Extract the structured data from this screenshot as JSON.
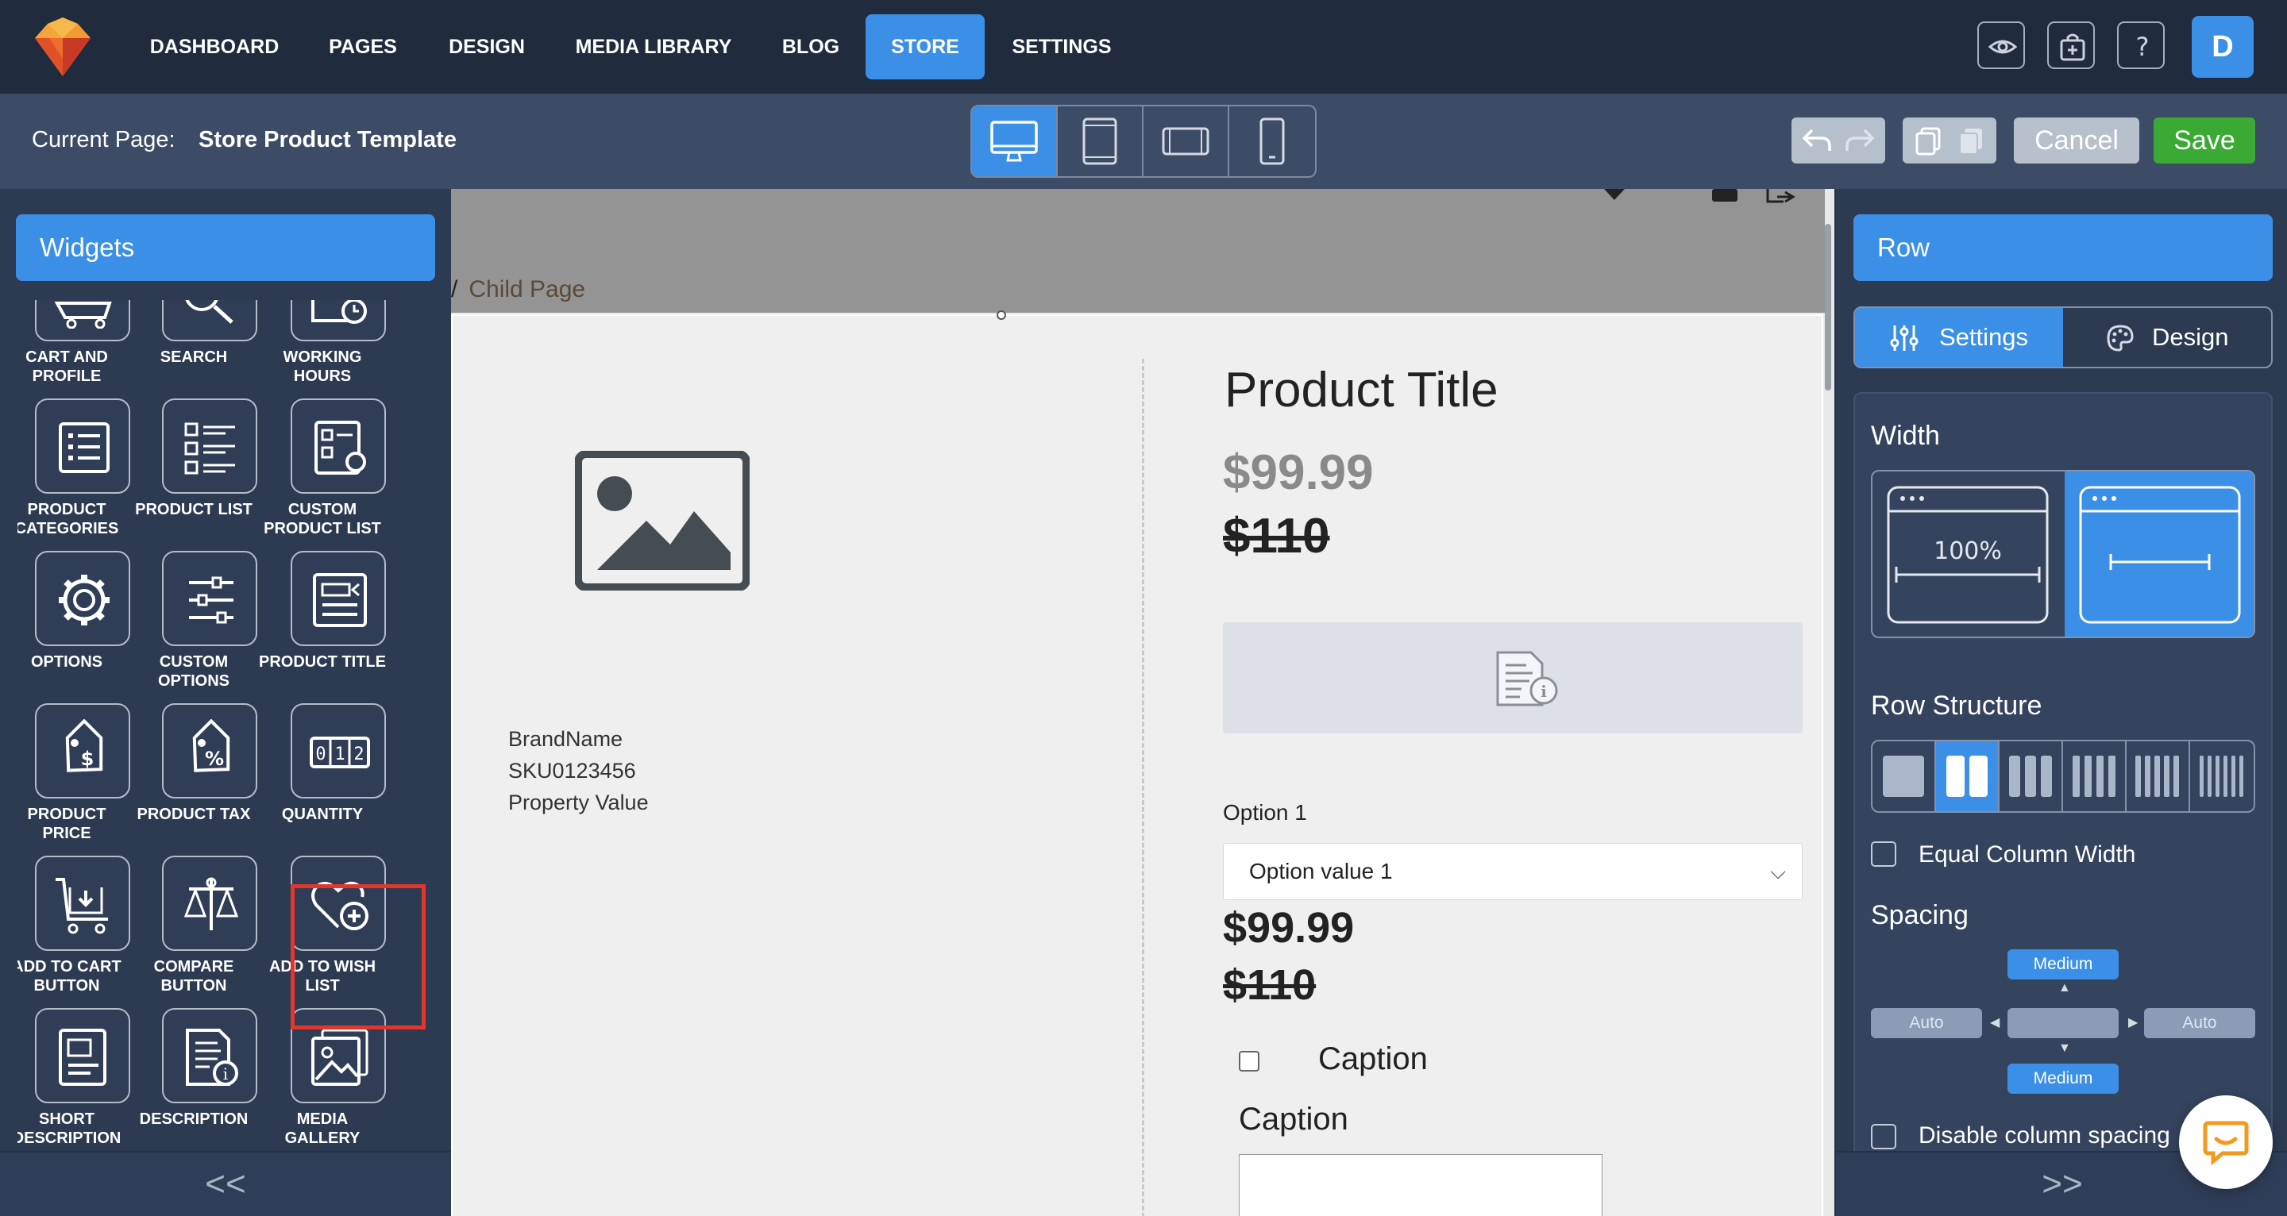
{
  "nav": {
    "items": [
      {
        "label": "DASHBOARD"
      },
      {
        "label": "PAGES"
      },
      {
        "label": "DESIGN"
      },
      {
        "label": "MEDIA LIBRARY"
      },
      {
        "label": "BLOG"
      },
      {
        "label": "STORE"
      },
      {
        "label": "SETTINGS"
      }
    ],
    "active": "STORE",
    "avatar_letter": "D",
    "icons": [
      "eye-icon",
      "store-icon",
      "help-icon"
    ]
  },
  "subbar": {
    "current_page_label": "Current Page:",
    "current_page_value": "Store Product Template",
    "devices": [
      "desktop-icon",
      "tablet-icon",
      "tablet-landscape-icon",
      "mobile-icon"
    ],
    "active_device": "desktop",
    "cancel_label": "Cancel",
    "save_label": "Save"
  },
  "left_panel": {
    "title": "Widgets",
    "widgets": [
      {
        "label": "CART AND PROFILE",
        "icon": "cart-icon"
      },
      {
        "label": "SEARCH",
        "icon": "search-icon"
      },
      {
        "label": "WORKING HOURS",
        "icon": "clock-icon"
      },
      {
        "label": "PRODUCT CATEGORIES",
        "icon": "list-icon"
      },
      {
        "label": "PRODUCT LIST",
        "icon": "product-list-icon"
      },
      {
        "label": "CUSTOM PRODUCT LIST",
        "icon": "custom-list-icon"
      },
      {
        "label": "OPTIONS",
        "icon": "gear-icon"
      },
      {
        "label": "CUSTOM OPTIONS",
        "icon": "sliders-icon"
      },
      {
        "label": "PRODUCT TITLE",
        "icon": "title-icon"
      },
      {
        "label": "PRODUCT PRICE",
        "icon": "price-tag-icon"
      },
      {
        "label": "PRODUCT TAX",
        "icon": "tax-tag-icon"
      },
      {
        "label": "QUANTITY",
        "icon": "quantity-icon"
      },
      {
        "label": "ADD TO CART BUTTON",
        "icon": "add-to-cart-icon"
      },
      {
        "label": "COMPARE BUTTON",
        "icon": "scale-icon"
      },
      {
        "label": "ADD TO WISH LIST",
        "icon": "heart-plus-icon"
      },
      {
        "label": "SHORT DESCRIPTION",
        "icon": "short-description-icon"
      },
      {
        "label": "DESCRIPTION",
        "icon": "description-icon"
      },
      {
        "label": "MEDIA GALLERY",
        "icon": "gallery-icon"
      }
    ],
    "highlighted": "QUANTITY",
    "footer": "<<"
  },
  "canvas": {
    "breadcrumb_sep": "/",
    "breadcrumb": "Child Page",
    "product_title": "Product Title",
    "price": "$99.99",
    "old_price": "$110",
    "brand": "BrandName",
    "sku": "SKU0123456",
    "property": "Property Value",
    "option_label": "Option 1",
    "option_value": "Option value 1",
    "caption_checkbox": "Caption",
    "caption_label": "Caption"
  },
  "right_panel": {
    "title": "Row",
    "tabs": [
      {
        "label": "Settings"
      },
      {
        "label": "Design"
      }
    ],
    "active_tab": "Settings",
    "width_title": "Width",
    "width_full_label": "100%",
    "row_structure_title": "Row Structure",
    "row_structure_active": 2,
    "equal_column_width": "Equal Column Width",
    "spacing_title": "Spacing",
    "spacing_top": "Medium",
    "spacing_bottom": "Medium",
    "spacing_left": "Auto",
    "spacing_right": "Auto",
    "disable_column_spacing": "Disable column spacing",
    "footer": ">>"
  },
  "colors": {
    "accent": "#3b8fe6",
    "nav_bg": "#202b3d",
    "panel_bg": "#2c3a52",
    "save": "#3aaa35",
    "highlight": "#e5352b"
  }
}
